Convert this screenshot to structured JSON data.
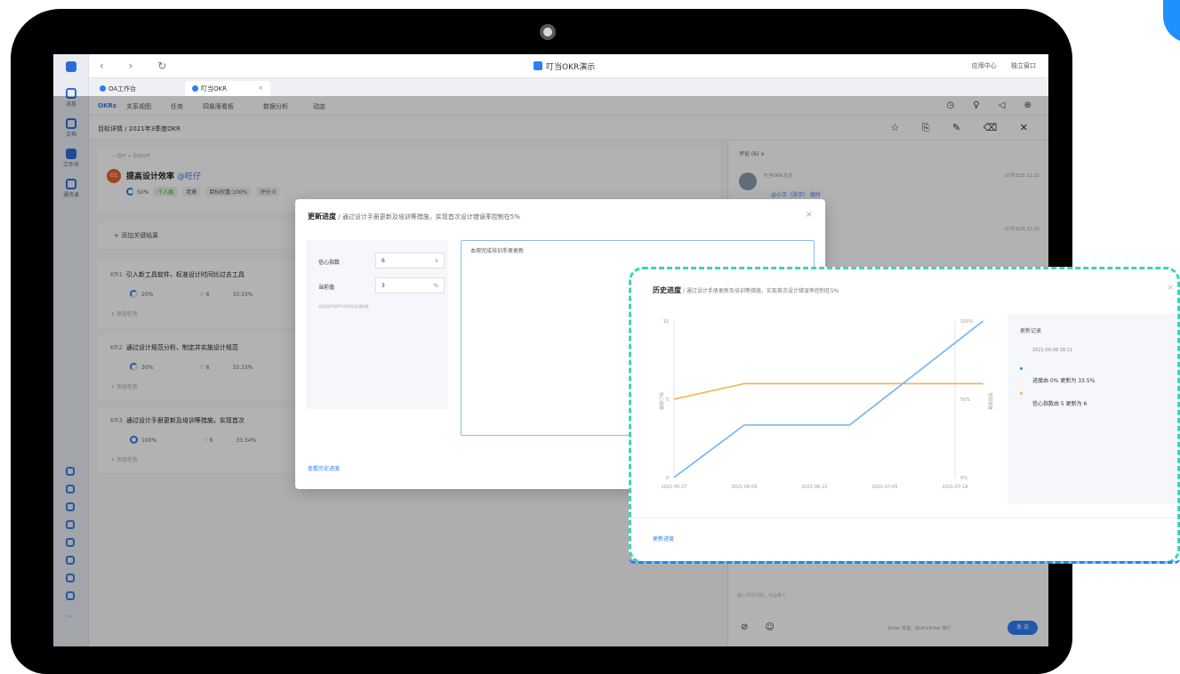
{
  "window": {
    "title": "叮当OKR演示",
    "nav_buttons": "‹ › ↻",
    "top_right": [
      "应用中心",
      "独立窗口"
    ]
  },
  "tabs": [
    {
      "label": "OA工作台"
    },
    {
      "label": "叮当OKR"
    }
  ],
  "rail": [
    {
      "label": "消息"
    },
    {
      "label": "文档"
    },
    {
      "label": "工作台"
    },
    {
      "label": "通讯录"
    }
  ],
  "app_nav": [
    "OKRs",
    "关系视图",
    "任务",
    "四象限看板",
    "数据分析",
    "动态"
  ],
  "sub_header": {
    "breadcrumb": "目标详情 / 2021年3季度OKR"
  },
  "objective": {
    "crumb": "→ 展开 + 添加对齐",
    "avatar": "O1",
    "title": "提高设计效率",
    "owner": "@旺仔",
    "progress": "50%",
    "chip_personal": "个人级",
    "chip_owner": "老章",
    "chip_weight": "目标权重:100%",
    "chip_score": "评分:0"
  },
  "add_kr": "+  添加关键结果",
  "krs": [
    {
      "code": "KR1",
      "title": "引入新工具软件，标准设计时间比过去工具",
      "progress": "20%",
      "confidence": "♡ 6",
      "weight": "33.33%",
      "add": "+  添加任务",
      "full": false
    },
    {
      "code": "KR2",
      "title": "通过设计规范分析，制定并实施设计规范",
      "progress": "30%",
      "confidence": "♡ 6",
      "weight": "33.33%",
      "add": "+  添加任务",
      "full": false
    },
    {
      "code": "KR3",
      "title": "通过设计手册更新及培训等措施，实现首次",
      "progress": "100%",
      "confidence": "♡ 6",
      "weight": "33.34%",
      "add": "+  添加任务",
      "full": true
    }
  ],
  "right_pane": {
    "header": "评论 (6)  ∨",
    "user": "叮当OKR·左龙",
    "ts1": "07月12日 11:15",
    "mention": "@小王（张宇） 按时",
    "ts2": "07月12日 11:15",
    "input_placeholder": "输入评论内容，可@某人",
    "send_hint": "Enter 发送，Shift+Enter 换行",
    "send": "发 送",
    "tools": "⊘ ☺"
  },
  "modal": {
    "title": "更新进度",
    "subtitle": " / 通过设计手册更新及培训等措施，实现首次设计错误率控制在5%",
    "close": "×",
    "conf_label": "信心指数",
    "conf_value": "6",
    "cur_label": "当前值",
    "cur_value": "3",
    "cur_suffix": "%",
    "hint": "实现由0%到5%的目标关键结果",
    "text": "本周完成培训手册更新",
    "foot": "查看历史进度"
  },
  "popup": {
    "title": "历史进度",
    "subtitle": " / 通过设计手册更新及培训等措施，实现首次设计错误率控制在5%",
    "close": "×",
    "side_title": "更新记录",
    "side_date": "2021-06-09 18:11",
    "entries": [
      "进度由 0% 更新为 33.5%",
      "信心指数由 5 更新为 6"
    ],
    "foot": "更新进度"
  },
  "colors": {
    "accent": "#2f7df6",
    "progress_line": "#6fb4f0",
    "confidence_line": "#f5b342",
    "popup_border": "#3bd6b7"
  },
  "chart_data": {
    "type": "line",
    "x": [
      "2021-05-27",
      "2021-06-09",
      "2021-06-22",
      "2021-07-05",
      "2021-07-18"
    ],
    "left_axis": {
      "label": "信心指数",
      "ticks": [
        "0",
        "5",
        "10"
      ],
      "ylim": [
        0,
        10
      ]
    },
    "right_axis": {
      "label": "当前进度",
      "ticks": [
        "0%",
        "50%",
        "100%"
      ],
      "ylim": [
        0,
        100
      ]
    },
    "series": [
      {
        "name": "信心指数",
        "axis": "left",
        "color": "#f5b342",
        "points": [
          [
            0,
            5
          ],
          [
            1,
            6
          ],
          [
            2,
            6
          ],
          [
            3,
            6
          ],
          [
            4,
            6
          ],
          [
            4.4,
            6
          ]
        ]
      },
      {
        "name": "当前进度",
        "axis": "right",
        "color": "#6fb4f0",
        "points": [
          [
            0,
            0
          ],
          [
            1,
            33.5
          ],
          [
            2,
            33.5
          ],
          [
            2.5,
            33.5
          ],
          [
            4.4,
            100
          ]
        ]
      }
    ]
  }
}
